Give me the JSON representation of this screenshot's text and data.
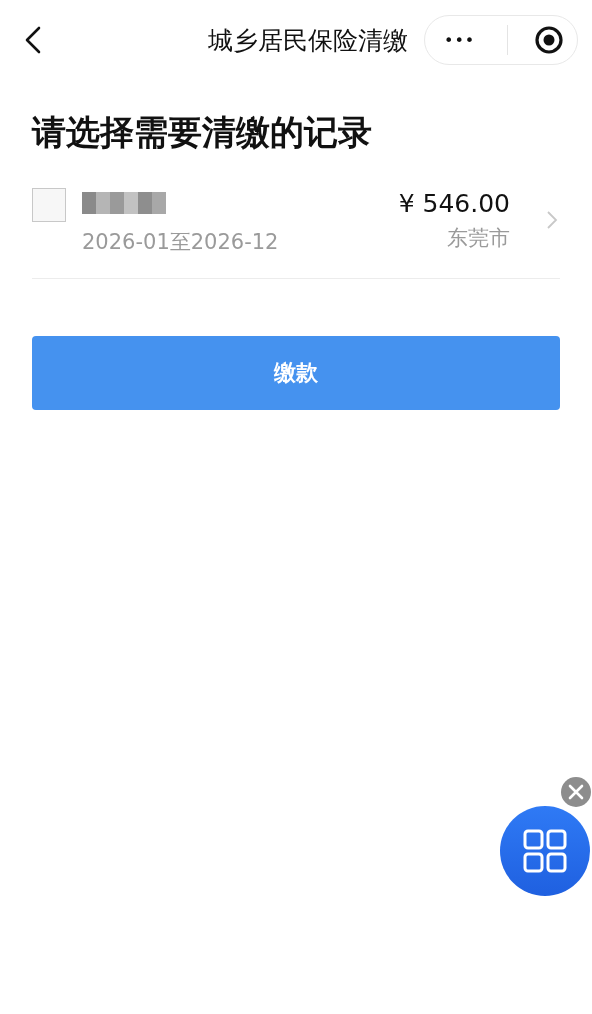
{
  "nav": {
    "title": "城乡居民保险清缴",
    "more": "•••"
  },
  "heading": "请选择需要清缴的记录",
  "records": [
    {
      "checked": false,
      "period": "2026-01至2026-12",
      "amount": "¥ 546.00",
      "city": "东莞市"
    }
  ],
  "pay_button": "缴款"
}
